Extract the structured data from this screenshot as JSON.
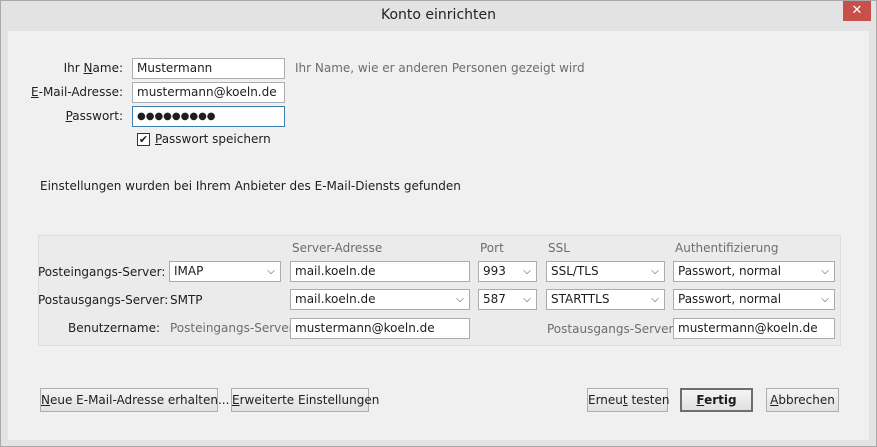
{
  "window": {
    "title": "Konto einrichten",
    "close_glyph": "✕"
  },
  "identity": {
    "name_label_pre": "Ihr ",
    "name_label_key": "N",
    "name_label_post": "ame:",
    "name_value": "Mustermann",
    "name_hint": "Ihr Name, wie er anderen Personen gezeigt wird",
    "email_label_key": "E",
    "email_label_post": "-Mail-Adresse:",
    "email_value": "mustermann@koeln.de",
    "password_label_key": "P",
    "password_label_post": "asswort:",
    "password_value": "●●●●●●●●●",
    "remember_checked": "✔",
    "remember_label_key": "P",
    "remember_label_post": "asswort speichern"
  },
  "status_message": "Einstellungen wurden bei Ihrem Anbieter des E-Mail-Diensts gefunden",
  "server": {
    "columns": {
      "address": "Server-Adresse",
      "port": "Port",
      "ssl": "SSL",
      "auth": "Authentifizierung"
    },
    "incoming": {
      "label": "Posteingangs-Server:",
      "protocol": "IMAP",
      "address": "mail.koeln.de",
      "port": "993",
      "ssl": "SSL/TLS",
      "auth": "Passwort, normal"
    },
    "outgoing": {
      "label": "Postausgangs-Server:",
      "protocol": "SMTP",
      "address": "mail.koeln.de",
      "port": "587",
      "ssl": "STARTTLS",
      "auth": "Passwort, normal"
    },
    "username": {
      "label": "Benutzername:",
      "incoming_label": "Posteingangs-Server:",
      "incoming_value": "mustermann@koeln.de",
      "outgoing_label": "Postausgangs-Server:",
      "outgoing_value": "mustermann@koeln.de"
    }
  },
  "buttons": {
    "new_email_key": "N",
    "new_email_post": "eue E-Mail-Adresse erhalten...",
    "advanced_key": "E",
    "advanced_post": "rweiterte Einstellungen",
    "retest_pre": "Erneu",
    "retest_key": "t",
    "retest_post": " testen",
    "done_key": "F",
    "done_post": "ertig",
    "cancel_key": "A",
    "cancel_post": "bbrechen"
  },
  "icons": {
    "dropdown": "chevron-down-icon",
    "close": "close-icon",
    "check": "checkmark-icon"
  }
}
